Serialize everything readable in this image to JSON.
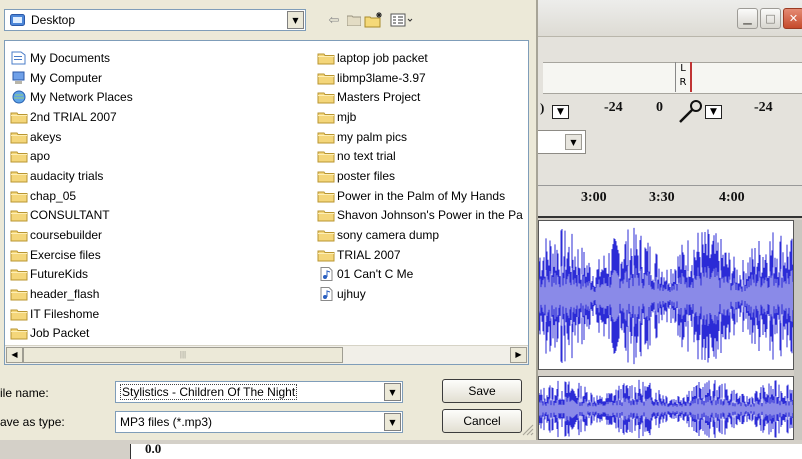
{
  "dialog": {
    "look_in": "Desktop",
    "items_left": [
      {
        "label": "My Documents",
        "icon": "my-documents-icon"
      },
      {
        "label": "My Computer",
        "icon": "my-computer-icon"
      },
      {
        "label": "My Network Places",
        "icon": "network-places-icon"
      },
      {
        "label": "2nd TRIAL 2007",
        "icon": "folder-icon"
      },
      {
        "label": "akeys",
        "icon": "folder-icon"
      },
      {
        "label": "apo",
        "icon": "folder-icon"
      },
      {
        "label": "audacity trials",
        "icon": "folder-icon"
      },
      {
        "label": "chap_05",
        "icon": "folder-icon"
      },
      {
        "label": "CONSULTANT",
        "icon": "folder-icon"
      },
      {
        "label": "coursebuilder",
        "icon": "folder-icon"
      },
      {
        "label": "Exercise files",
        "icon": "folder-icon"
      },
      {
        "label": "FutureKids",
        "icon": "folder-icon"
      },
      {
        "label": "header_flash",
        "icon": "folder-icon"
      },
      {
        "label": "IT Fileshome",
        "icon": "folder-icon"
      },
      {
        "label": "Job Packet",
        "icon": "folder-icon"
      }
    ],
    "items_right": [
      {
        "label": "laptop job packet",
        "icon": "folder-icon"
      },
      {
        "label": "libmp3lame-3.97",
        "icon": "folder-icon"
      },
      {
        "label": "Masters Project",
        "icon": "folder-icon"
      },
      {
        "label": "mjb",
        "icon": "folder-icon"
      },
      {
        "label": "my palm pics",
        "icon": "folder-icon"
      },
      {
        "label": "no text trial",
        "icon": "folder-icon"
      },
      {
        "label": "poster files",
        "icon": "folder-icon"
      },
      {
        "label": "Power in the Palm of My Hands",
        "icon": "folder-icon"
      },
      {
        "label": "Shavon Johnson's Power in the Pa",
        "icon": "folder-icon"
      },
      {
        "label": "sony camera dump",
        "icon": "folder-icon"
      },
      {
        "label": "TRIAL 2007",
        "icon": "folder-icon"
      },
      {
        "label": "01 Can't C Me",
        "icon": "audio-file-icon"
      },
      {
        "label": "ujhuy",
        "icon": "audio-file-icon"
      }
    ],
    "file_name_label": "ile name:",
    "file_name_value": "Stylistics - Children Of The Night",
    "save_as_type_label": "ave as type:",
    "save_as_type_value": "MP3 files (*.mp3)",
    "save_button": "Save",
    "cancel_button": "Cancel"
  },
  "background": {
    "meter_labels": {
      "left_marker": "L",
      "right_marker": "R"
    },
    "meter_values": [
      "-24",
      "0",
      "-24"
    ],
    "meter_prefix": ")",
    "timeline": [
      "3:00",
      "3:30",
      "4:00"
    ],
    "bottom_value": "0.0",
    "wave_color": "#2b2bd6",
    "wave_light": "#8a8ae8"
  }
}
